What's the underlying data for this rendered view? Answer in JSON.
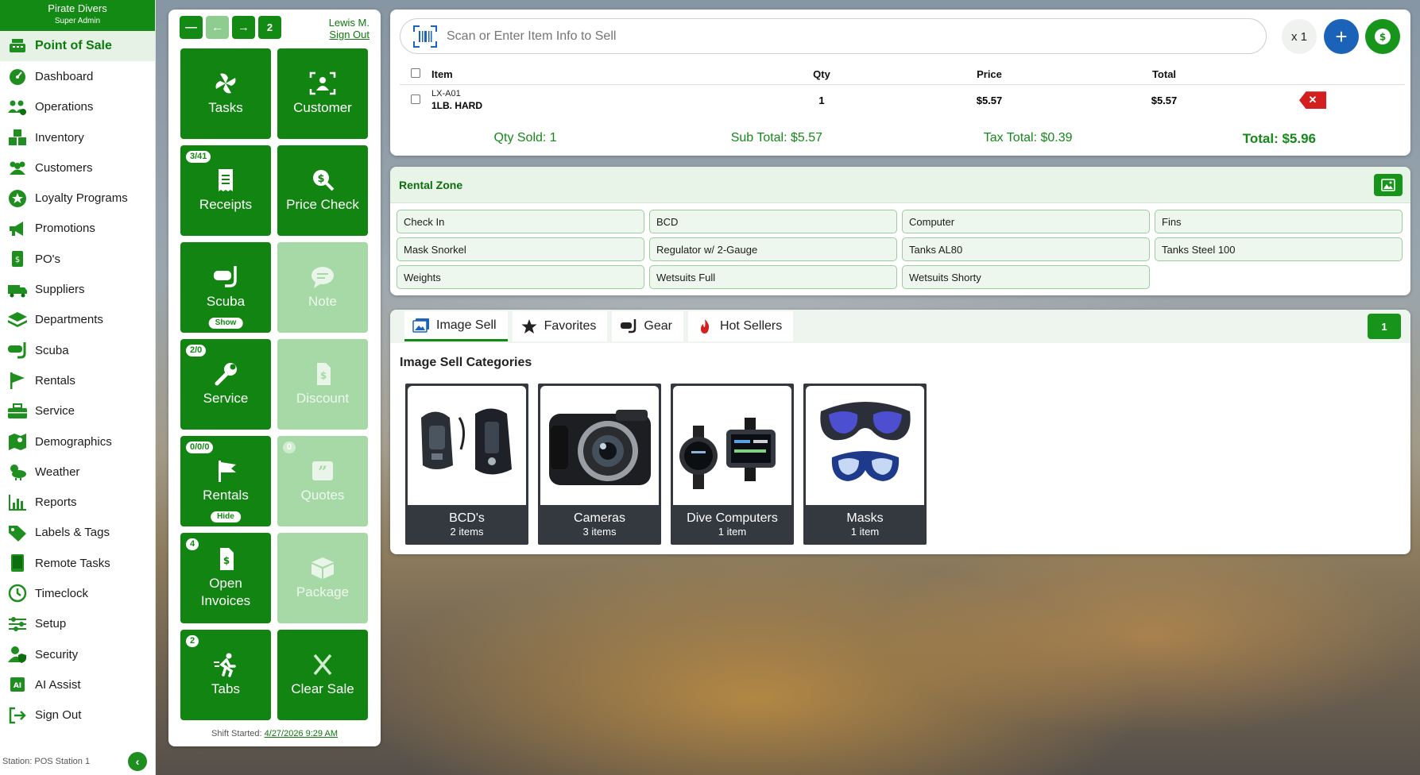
{
  "store": {
    "name": "Pirate Divers",
    "role": "Super Admin"
  },
  "sidebar": {
    "items": [
      {
        "label": "Point of Sale",
        "icon": "register-icon",
        "active": true
      },
      {
        "label": "Dashboard",
        "icon": "dashboard-gauge-icon"
      },
      {
        "label": "Operations",
        "icon": "operations-people-gear-icon"
      },
      {
        "label": "Inventory",
        "icon": "inventory-boxes-icon"
      },
      {
        "label": "Customers",
        "icon": "customers-people-icon"
      },
      {
        "label": "Loyalty Programs",
        "icon": "loyalty-star-icon"
      },
      {
        "label": "Promotions",
        "icon": "megaphone-icon"
      },
      {
        "label": "PO's",
        "icon": "purchase-order-icon"
      },
      {
        "label": "Suppliers",
        "icon": "truck-icon"
      },
      {
        "label": "Departments",
        "icon": "layers-icon"
      },
      {
        "label": "Scuba",
        "icon": "scuba-mask-icon"
      },
      {
        "label": "Rentals",
        "icon": "flag-icon"
      },
      {
        "label": "Service",
        "icon": "toolbox-icon"
      },
      {
        "label": "Demographics",
        "icon": "map-icon"
      },
      {
        "label": "Weather",
        "icon": "weather-icon"
      },
      {
        "label": "Reports",
        "icon": "bar-chart-icon"
      },
      {
        "label": "Labels & Tags",
        "icon": "tag-icon"
      },
      {
        "label": "Remote Tasks",
        "icon": "tablet-icon"
      },
      {
        "label": "Timeclock",
        "icon": "clock-icon"
      },
      {
        "label": "Setup",
        "icon": "sliders-icon"
      },
      {
        "label": "Security",
        "icon": "user-shield-icon"
      },
      {
        "label": "AI Assist",
        "icon": "ai-chip-icon"
      },
      {
        "label": "Sign Out",
        "icon": "sign-out-icon"
      }
    ],
    "station": "Station: POS Station 1"
  },
  "tile_panel": {
    "top_count": "2",
    "user_name": "Lewis M.",
    "sign_out": "Sign Out",
    "tiles": [
      {
        "label": "Tasks",
        "icon": "pinwheel-icon",
        "badge": "",
        "sub": ""
      },
      {
        "label": "Customer",
        "icon": "customer-scan-icon",
        "badge": "",
        "sub": ""
      },
      {
        "label": "Receipts",
        "icon": "receipt-icon",
        "badge": "3/41",
        "sub": ""
      },
      {
        "label": "Price Check",
        "icon": "price-check-icon",
        "badge": "",
        "sub": ""
      },
      {
        "label": "Scuba",
        "icon": "scuba-mask-icon",
        "badge": "",
        "sub": "Show"
      },
      {
        "label": "Note",
        "icon": "note-bubble-icon",
        "badge": "",
        "sub": ""
      },
      {
        "label": "Service",
        "icon": "wrench-icon",
        "badge": "2/0",
        "sub": ""
      },
      {
        "label": "Discount",
        "icon": "discount-icon",
        "badge": "",
        "sub": ""
      },
      {
        "label": "Rentals",
        "icon": "flag-icon",
        "badge": "0/0/0",
        "sub": "Hide"
      },
      {
        "label": "Quotes",
        "icon": "quote-icon",
        "badge": "0",
        "sub": ""
      },
      {
        "label": "Open Invoices",
        "icon": "invoice-icon",
        "badge": "4",
        "sub": ""
      },
      {
        "label": "Package",
        "icon": "package-box-icon",
        "badge": "",
        "sub": ""
      },
      {
        "label": "Tabs",
        "icon": "running-person-icon",
        "badge": "2",
        "sub": ""
      },
      {
        "label": "Clear Sale",
        "icon": "close-x-icon",
        "badge": "",
        "sub": ""
      }
    ],
    "shift_label": "Shift Started:",
    "shift_time": "4/27/2026 9:29 AM"
  },
  "cart": {
    "search_placeholder": "Scan or Enter Item Info to Sell",
    "qty_multiplier": "x 1",
    "columns": {
      "item": "Item",
      "qty": "Qty",
      "price": "Price",
      "total": "Total"
    },
    "rows": [
      {
        "sku": "LX-A01",
        "name": "1LB. HARD",
        "qty": "1",
        "price": "$5.57",
        "total": "$5.57"
      }
    ],
    "summary": {
      "qty_sold": "Qty Sold: 1",
      "sub_total": "Sub Total: $5.57",
      "tax_total": "Tax Total: $0.39",
      "total": "Total: $5.96"
    }
  },
  "rental_zone": {
    "title": "Rental Zone",
    "buttons": [
      "Check In",
      "BCD",
      "Computer",
      "Fins",
      "Mask Snorkel",
      "Regulator w/ 2-Gauge",
      "Tanks AL80",
      "Tanks Steel 100",
      "Weights",
      "Wetsuits Full",
      "Wetsuits Shorty"
    ]
  },
  "image_sell": {
    "tabs": [
      {
        "label": "Image Sell",
        "icon": "image-gallery-icon",
        "active": true
      },
      {
        "label": "Favorites",
        "icon": "star-icon"
      },
      {
        "label": "Gear",
        "icon": "scuba-mask-icon"
      },
      {
        "label": "Hot Sellers",
        "icon": "fire-icon"
      }
    ],
    "page": "1",
    "heading": "Image Sell Categories",
    "categories": [
      {
        "name": "BCD's",
        "count": "2 items",
        "image": "bcd-vests-image"
      },
      {
        "name": "Cameras",
        "count": "3 items",
        "image": "camera-image"
      },
      {
        "name": "Dive Computers",
        "count": "1 item",
        "image": "dive-computer-image"
      },
      {
        "name": "Masks",
        "count": "1 item",
        "image": "dive-masks-image"
      }
    ]
  },
  "colors": {
    "primary_green": "#138a13",
    "danger_red": "#d41f1f",
    "action_blue": "#1a63b8"
  }
}
